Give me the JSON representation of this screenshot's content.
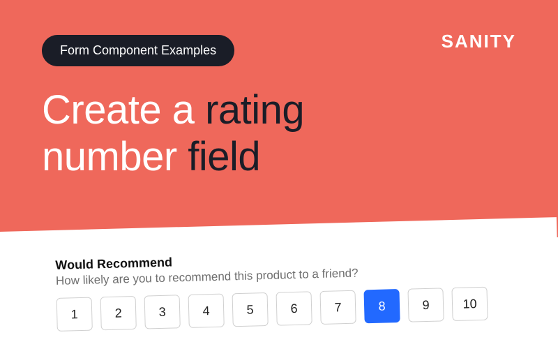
{
  "hero": {
    "pill_label": "Form Component Examples",
    "logo_text": "SANITY",
    "title_part1": "Create a ",
    "title_part2": "rating",
    "title_part3": "number ",
    "title_part4": "field"
  },
  "form": {
    "label": "Would Recommend",
    "description": "How likely are you to recommend this product to a friend?",
    "selected_value": 8,
    "options": [
      1,
      2,
      3,
      4,
      5,
      6,
      7,
      8,
      9,
      10
    ]
  }
}
